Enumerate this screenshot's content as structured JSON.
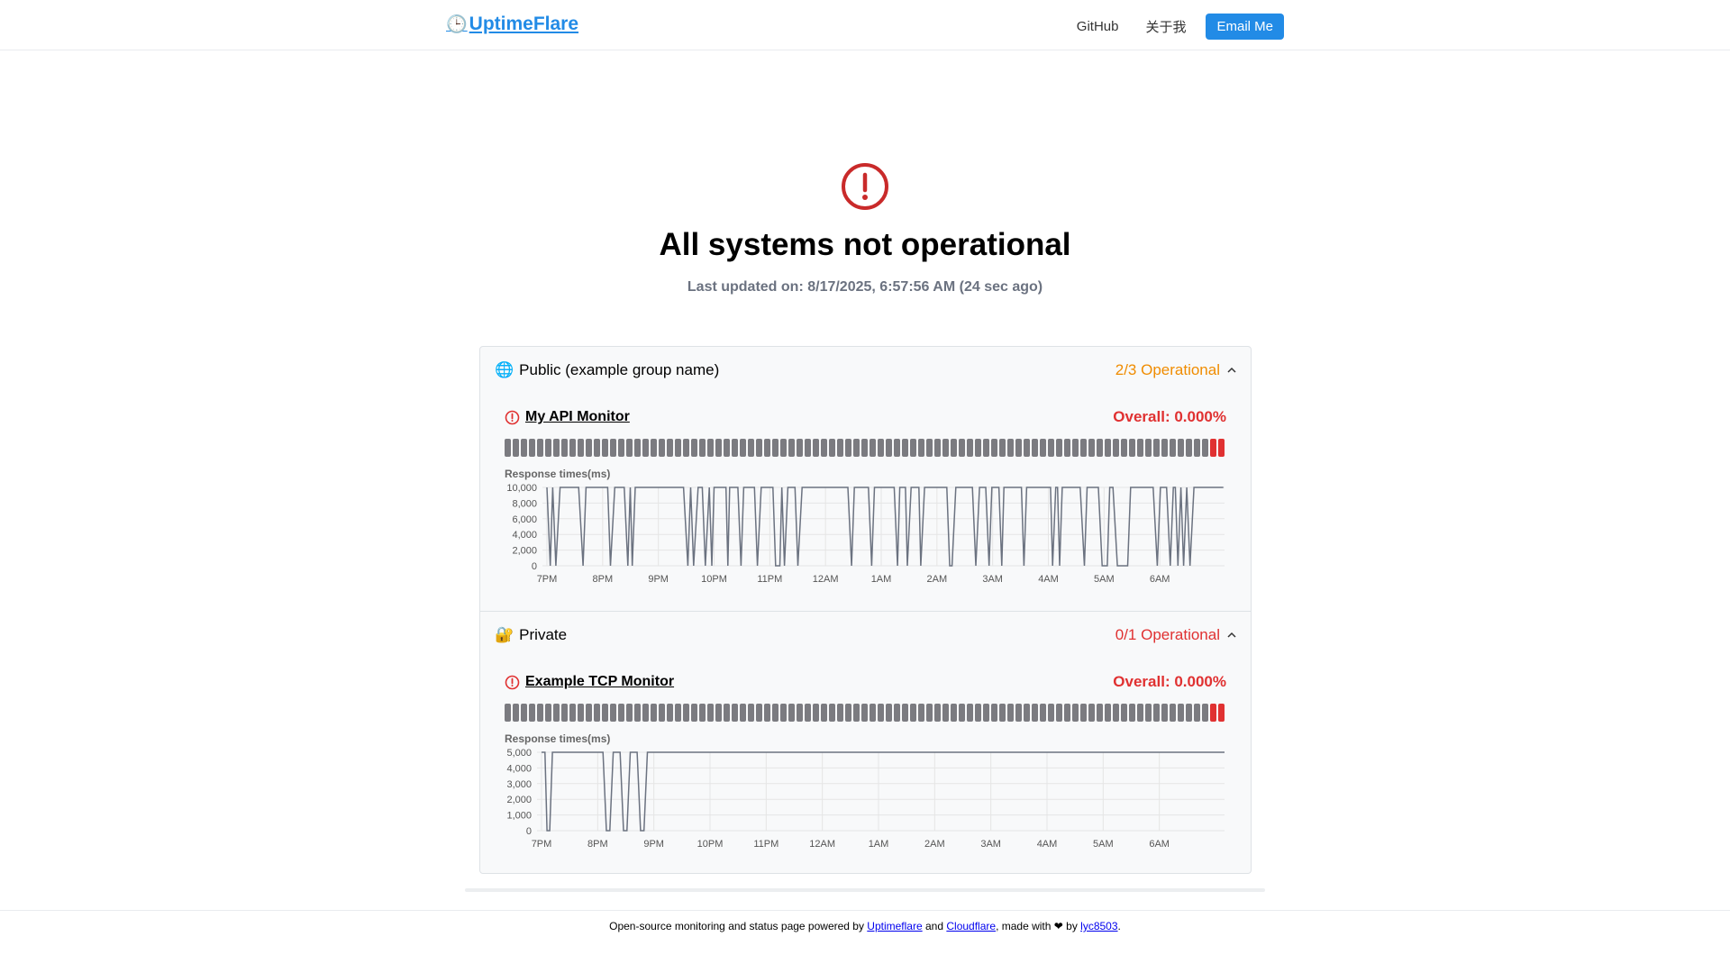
{
  "header": {
    "logo_icon": "🕒",
    "logo_text": "UptimeFlare",
    "nav": [
      "GitHub",
      "关于我"
    ],
    "email_label": "Email Me"
  },
  "status": {
    "icon": "alert-circle-icon",
    "color": "#c92a2a",
    "title": "All systems not operational",
    "updated": "Last updated on: 8/17/2025, 6:57:56 AM (24 sec ago)"
  },
  "groups": [
    {
      "icon": "🌐",
      "name": "Public (example group name)",
      "status": "2/3 Operational",
      "status_color": "#f08c00",
      "monitor": {
        "name": "My API Monitor",
        "overall": "Overall: 0.000%",
        "rt_label": "Response times(ms)"
      }
    },
    {
      "icon": "🔐",
      "name": "Private",
      "status": "0/1 Operational",
      "status_color": "#e03131",
      "monitor": {
        "name": "Example TCP Monitor",
        "overall": "Overall: 0.000%",
        "rt_label": "Response times(ms)"
      }
    }
  ],
  "chart_data": [
    {
      "type": "line",
      "ylabel": "Response times(ms)",
      "ylim": [
        0,
        10000
      ],
      "yticks": [
        "10,000",
        "8,000",
        "6,000",
        "4,000",
        "2,000",
        "0"
      ],
      "x_ticks": [
        "7PM",
        "8PM",
        "9PM",
        "10PM",
        "11PM",
        "12AM",
        "1AM",
        "2AM",
        "3AM",
        "4AM",
        "5AM",
        "6AM"
      ],
      "pattern": "oscillating between 0 and 10000"
    },
    {
      "type": "line",
      "ylabel": "Response times(ms)",
      "ylim": [
        0,
        5000
      ],
      "yticks": [
        "5,000",
        "4,000",
        "3,000",
        "2,000",
        "1,000",
        "0"
      ],
      "x_ticks": [
        "7PM",
        "8PM",
        "9PM",
        "10PM",
        "11PM",
        "12AM",
        "1AM",
        "2AM",
        "3AM",
        "4AM",
        "5AM",
        "6AM"
      ],
      "pattern": "mostly 5000 with drops to 0 near 7PM and 8PM-9PM"
    }
  ],
  "footer": {
    "t1": "Open-source monitoring and status page powered by ",
    "l1": "Uptimeflare",
    "t2": " and ",
    "l2": "Cloudflare",
    "t3": ", made with ❤ by ",
    "l3": "lyc8503",
    "t4": "."
  }
}
